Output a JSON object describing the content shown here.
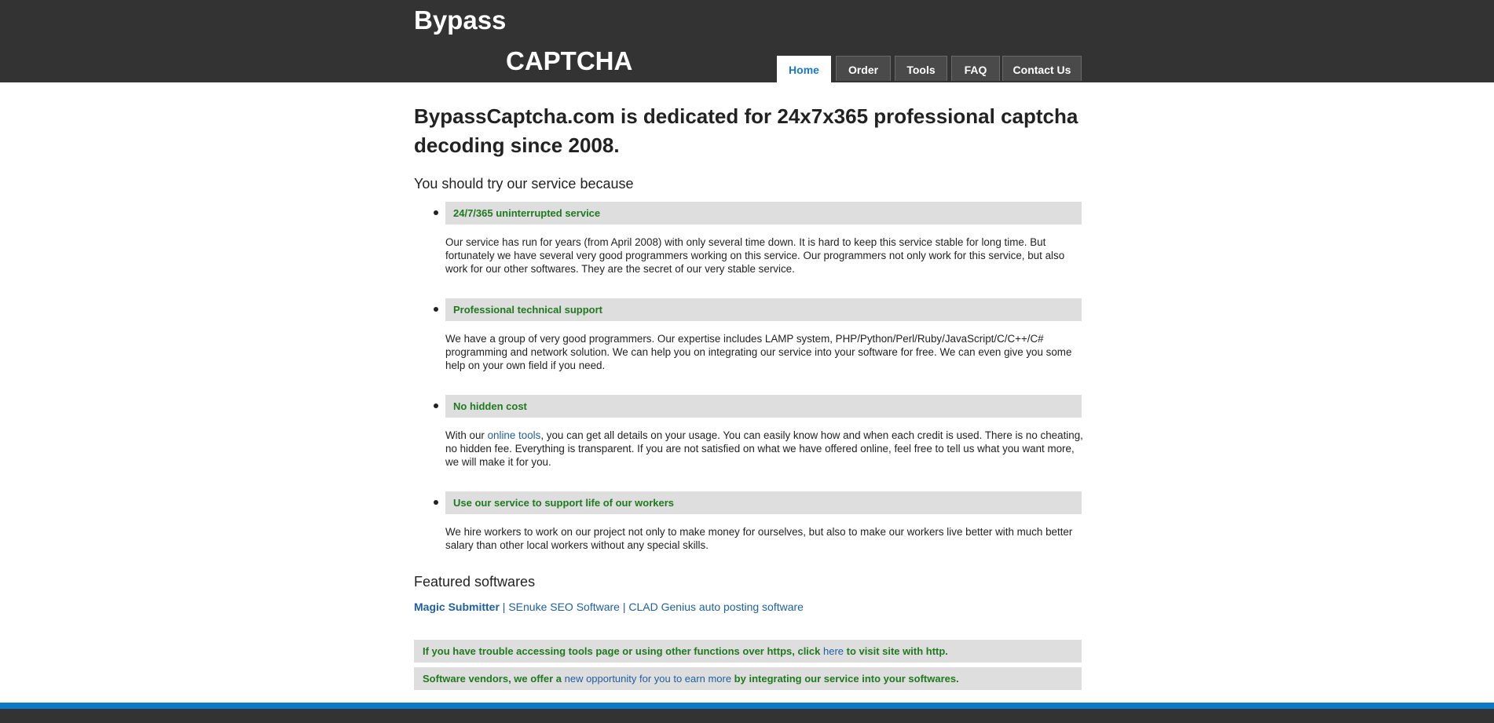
{
  "header": {
    "logo_line1": "Bypass",
    "logo_line2": "CAPTCHA"
  },
  "nav": {
    "tabs": [
      {
        "label": "Home",
        "active": true
      },
      {
        "label": "Order",
        "active": false
      },
      {
        "label": "Tools",
        "active": false
      },
      {
        "label": "FAQ",
        "active": false
      },
      {
        "label": "Contact Us",
        "active": false
      }
    ]
  },
  "main": {
    "title": "BypassCaptcha.com is dedicated for 24x7x365 professional captcha decoding since 2008.",
    "intro": "You should try our service because",
    "features": [
      {
        "heading": "24/7/365 uninterrupted service",
        "body": "Our service has run for years (from April 2008) with only several time down. It is hard to keep this service stable for long time. But fortunately we have several very good programmers working on this service. Our programmers not only work for this service, but also work for our other softwares. They are the secret of our very stable service."
      },
      {
        "heading": "Professional technical support",
        "body": "We have a group of very good programmers. Our expertise includes LAMP system, PHP/Python/Perl/Ruby/JavaScript/C/C++/C# programming and network solution. We can help you on integrating our service into your software for free. We can even give you some help on your own field if you need."
      },
      {
        "heading": "No hidden cost",
        "body_before": "With our ",
        "body_link": "online tools",
        "body_after": ", you can get all details on your usage. You can easily know how and when each credit is used. There is no cheating, no hidden fee. Everything is transparent. If you are not satisfied on what we have offered online, feel free to tell us what you want more, we will make it for you."
      },
      {
        "heading": "Use our service to support life of our workers",
        "body": "We hire workers to work on our project not only to make money for ourselves, but also to make our workers live better with much better salary than other local workers without any special skills."
      }
    ],
    "featured_heading": "Featured softwares",
    "software": [
      "Magic Submitter",
      "SEnuke SEO Software",
      "CLAD Genius auto posting software"
    ],
    "separator": " | ",
    "note1": {
      "before": "If you have trouble accessing tools page or using other functions over https, click ",
      "link": "here",
      "after": " to visit site with http."
    },
    "note2": {
      "before": "Software vendors, we offer a ",
      "link": "new opportunity for you to earn more",
      "after": " by integrating our service into your softwares."
    }
  },
  "colors": {
    "header_bg": "#333333",
    "accent_blue": "#0a7ac7",
    "feature_green": "#1f7a1f",
    "link_blue": "#1f5fa0"
  }
}
